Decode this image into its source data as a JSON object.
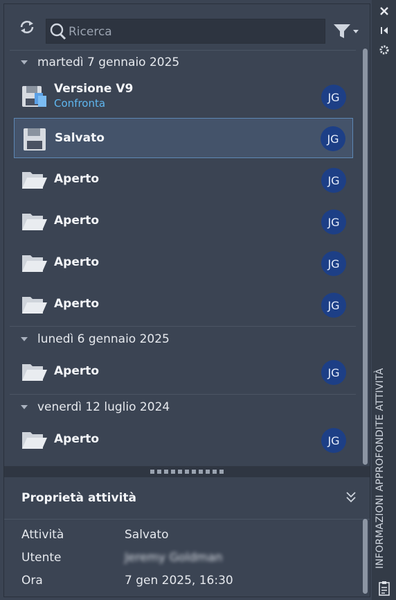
{
  "toolbar": {
    "search_placeholder": "Ricerca",
    "refresh_icon": "refresh-icon",
    "filter_icon": "filter-icon"
  },
  "sidebar": {
    "label": "INFORMAZIONI APPROFONDITE ATTIVITÀ",
    "icons": [
      "close-icon",
      "dock-icon",
      "settings-icon",
      "clipboard-icon"
    ]
  },
  "groups": [
    {
      "date": "martedì 7 gennaio 2025",
      "items": [
        {
          "title": "Versione V9",
          "subtitle": "Confronta",
          "icon": "version-save-icon",
          "user": "JG"
        },
        {
          "title": "Salvato",
          "icon": "floppy-disk-icon",
          "user": "JG",
          "selected": true
        },
        {
          "title": "Aperto",
          "icon": "folder-open-icon",
          "user": "JG"
        },
        {
          "title": "Aperto",
          "icon": "folder-open-icon",
          "user": "JG"
        },
        {
          "title": "Aperto",
          "icon": "folder-open-icon",
          "user": "JG"
        },
        {
          "title": "Aperto",
          "icon": "folder-open-icon",
          "user": "JG"
        }
      ]
    },
    {
      "date": "lunedì 6 gennaio 2025",
      "items": [
        {
          "title": "Aperto",
          "icon": "folder-open-icon",
          "user": "JG"
        }
      ]
    },
    {
      "date": "venerdì 12 luglio 2024",
      "items": [
        {
          "title": "Aperto",
          "icon": "folder-open-icon",
          "user": "JG"
        }
      ]
    }
  ],
  "properties": {
    "title": "Proprietà attività",
    "rows": [
      {
        "label": "Attività",
        "value": "Salvato"
      },
      {
        "label": "Utente",
        "value": "Jeremy Goldman"
      },
      {
        "label": "Ora",
        "value": "7 gen 2025, 16:30"
      }
    ]
  },
  "colors": {
    "background": "#3b4453",
    "selection": "#44536a",
    "selection_border": "#5e88b5",
    "avatar": "#1d3f86",
    "link": "#5fb7f0"
  }
}
